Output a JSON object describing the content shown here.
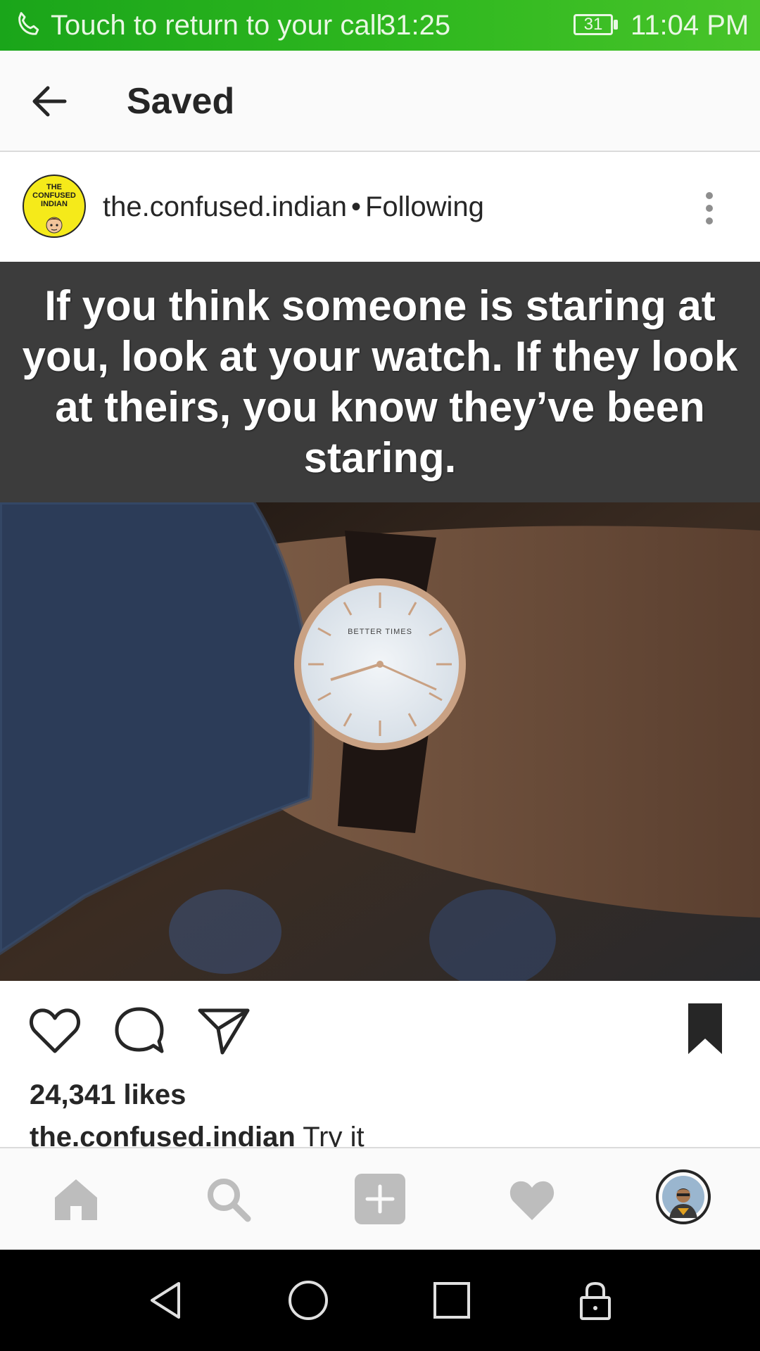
{
  "status_bar": {
    "call_text": "Touch to return to your call",
    "call_timer": "31:25",
    "battery_level": "31",
    "time": "11:04 PM",
    "color": "#2fb81f"
  },
  "header": {
    "title": "Saved",
    "back_icon": "arrow-left-icon"
  },
  "post": {
    "username": "the.confused.indian",
    "separator": "•",
    "follow_status": "Following",
    "avatar_text": "THE CONFUSED INDIAN",
    "image_caption": "If you think someone is staring at you, look at your watch. If they look at theirs, you know they’ve been staring.",
    "watch_brand": "BETTER TIMES",
    "likes": "24,341 likes",
    "caption_user": "the.confused.indian",
    "caption_text": "Try it"
  },
  "actions": {
    "like_icon": "heart-outline-icon",
    "comment_icon": "comment-icon",
    "share_icon": "paper-plane-icon",
    "save_icon": "bookmark-filled-icon"
  },
  "bottom_nav": {
    "items": [
      "home-icon",
      "search-icon",
      "add-icon",
      "activity-heart-icon",
      "profile-avatar"
    ]
  },
  "system_nav": {
    "items": [
      "back-triangle-icon",
      "home-circle-icon",
      "recents-square-icon",
      "lock-icon"
    ]
  }
}
